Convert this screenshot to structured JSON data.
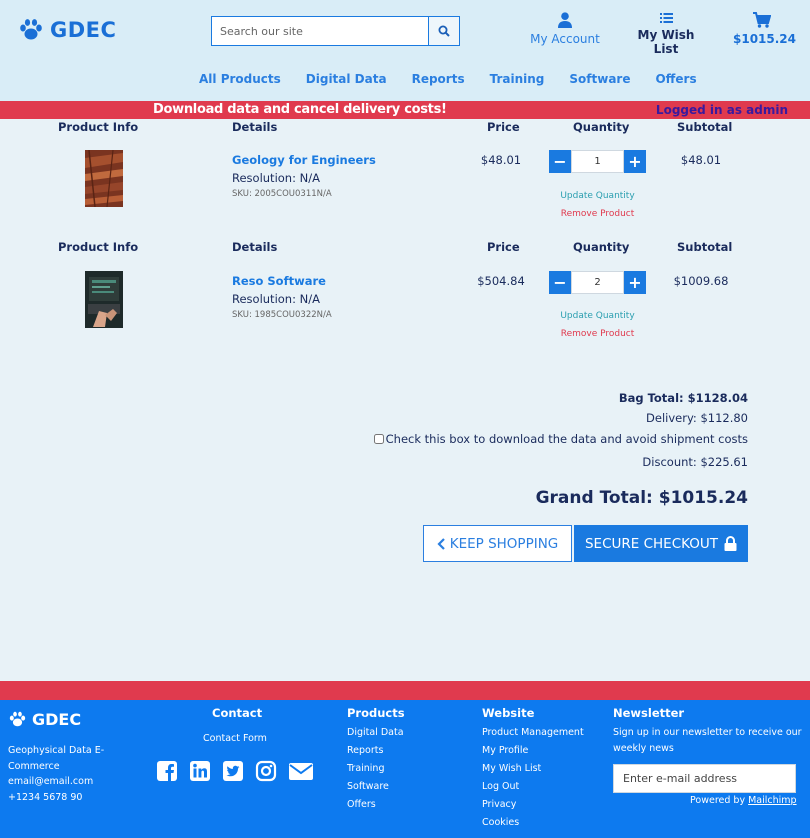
{
  "header": {
    "logo_text": "GDEC",
    "search_placeholder": "Search our site",
    "account_label": "My Account",
    "wishlist_label": "My Wish List",
    "cart_total": "$1015.24",
    "nav": [
      "All Products",
      "Digital Data",
      "Reports",
      "Training",
      "Software",
      "Offers"
    ]
  },
  "banner": {
    "message": "Download data and cancel delivery costs!",
    "login_status": "Logged in as admin"
  },
  "table_headers": {
    "info": "Product Info",
    "details": "Details",
    "price": "Price",
    "quantity": "Quantity",
    "subtotal": "Subtotal"
  },
  "items": [
    {
      "name": "Geology for Engineers",
      "resolution": "Resolution: N/A",
      "sku": "SKU: 2005COU0311N/A",
      "price": "$48.01",
      "quantity": "1",
      "subtotal": "$48.01",
      "update_label": "Update Quantity",
      "remove_label": "Remove Product"
    },
    {
      "name": "Reso Software",
      "resolution": "Resolution: N/A",
      "sku": "SKU: 1985COU0322N/A",
      "price": "$504.84",
      "quantity": "2",
      "subtotal": "$1009.68",
      "update_label": "Update Quantity",
      "remove_label": "Remove Product"
    }
  ],
  "totals": {
    "bag_total": "Bag Total: $1128.04",
    "delivery": "Delivery: $112.80",
    "checkbox_label": "Check this box to download the data and avoid shipment costs",
    "discount": "Discount: $225.61",
    "grand_total": "Grand Total: $1015.24",
    "keep_shopping": "KEEP SHOPPING",
    "secure_checkout": "SECURE CHECKOUT"
  },
  "footer": {
    "logo_text": "GDEC",
    "description": "Geophysical Data E-Commerce",
    "email": "email@email.com",
    "phone": "+1234 5678 90",
    "contact_heading": "Contact",
    "contact_form": "Contact Form",
    "products_heading": "Products",
    "products": [
      "Digital Data",
      "Reports",
      "Training",
      "Software",
      "Offers"
    ],
    "website_heading": "Website",
    "website": [
      "Product Management",
      "My Profile",
      "My Wish List",
      "Log Out",
      "Privacy",
      "Cookies"
    ],
    "newsletter_heading": "Newsletter",
    "newsletter_text": "Sign up in our newsletter to receive our weekly news",
    "newsletter_placeholder": "Enter e-mail address",
    "powered_by": "Powered by",
    "powered_link": "Mailchimp"
  },
  "colors": {
    "brand_blue": "#1a7ae0",
    "accent_red": "#e03a4e",
    "navy": "#1a2b5c",
    "footer_blue": "#0d7aef"
  }
}
